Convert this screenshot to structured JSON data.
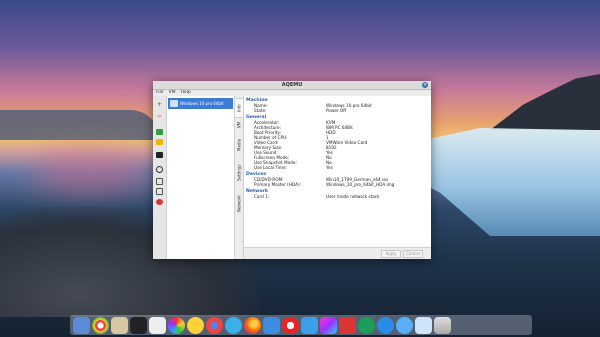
{
  "window": {
    "title": "AQEMU"
  },
  "menu": [
    "File",
    "VM",
    "Help"
  ],
  "vm_list": [
    {
      "name": "Windows 10 pro 64bit",
      "selected": true
    }
  ],
  "side_tabs": [
    "Info",
    "VM",
    "Media",
    "Settings",
    "Network"
  ],
  "info": {
    "machine": {
      "title": "Machine",
      "rows": [
        {
          "key": "Name:",
          "value": "Windows 10 pro 64bit"
        },
        {
          "key": "State:",
          "value": "Power Off"
        }
      ]
    },
    "general": {
      "title": "General",
      "rows": [
        {
          "key": "Accelerator:",
          "value": "KVM"
        },
        {
          "key": "Architecture:",
          "value": "IBM PC 64Bit"
        },
        {
          "key": "Boot Priority:",
          "value": "HDD"
        },
        {
          "key": "Number of CPU:",
          "value": "1"
        },
        {
          "key": "Video Card:",
          "value": "VMWare Video Card"
        },
        {
          "key": "Memory Size:",
          "value": "8192"
        },
        {
          "key": "Use Sound:",
          "value": "Yes"
        },
        {
          "key": "Fullscreen Mode:",
          "value": "No"
        },
        {
          "key": "Use Snapshot Mode:",
          "value": "No"
        },
        {
          "key": "Use Local Time:",
          "value": "Yes"
        }
      ]
    },
    "devices": {
      "title": "Devices",
      "rows": [
        {
          "key": "CD/DVD-ROM:",
          "value": "Win10_1709_German_x64.iso"
        },
        {
          "key": "Primary Master (HDA):",
          "value": "Windows_10_pro_64bit_HDA.img"
        }
      ]
    },
    "network": {
      "title": "Network",
      "rows": [
        {
          "key": "Card 1:",
          "value": "User mode network stack"
        }
      ]
    }
  },
  "buttons": {
    "apply": "Apply",
    "cancel": "Cancel"
  },
  "colors": {
    "accent": "#3d7cd6",
    "section": "#2a5ca8"
  },
  "toolbar_icons": [
    "add-vm-icon",
    "remove-vm-icon",
    "start-icon",
    "pause-icon",
    "stop-icon",
    "screenshot-icon",
    "save-icon",
    "reset-icon",
    "settings-icon"
  ],
  "dock_icons": [
    "finder-icon",
    "chrome-icon",
    "settings-icon",
    "terminal-icon",
    "photo-icon",
    "colors-icon",
    "app-icon",
    "browser-icon",
    "messages-icon",
    "firefox-icon",
    "mail-icon",
    "opera-icon",
    "news-icon",
    "video-icon",
    "word-icon",
    "office-icon",
    "maps-icon",
    "appstore-icon",
    "finder-window-icon",
    "trash-icon"
  ]
}
